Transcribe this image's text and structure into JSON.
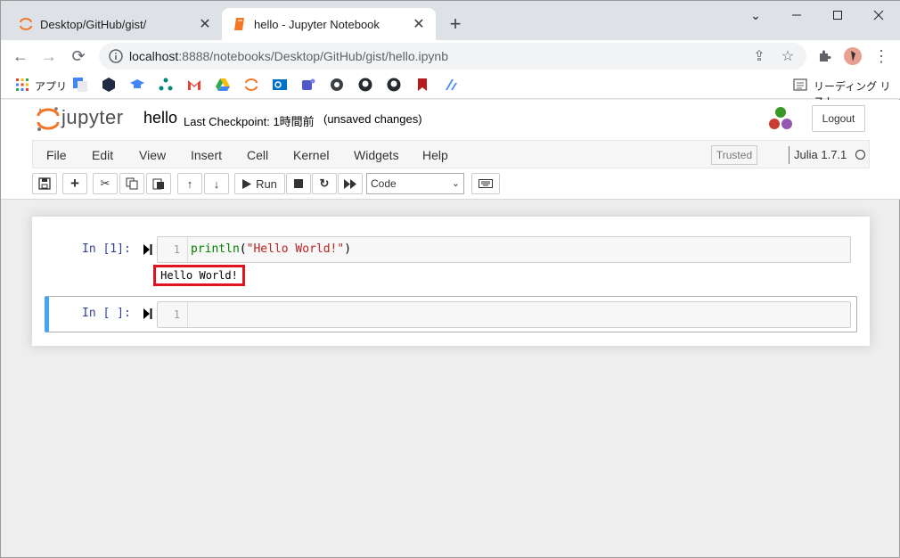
{
  "browser": {
    "tabs": [
      {
        "title": "Desktop/GitHub/gist/",
        "active": false
      },
      {
        "title": "hello - Jupyter Notebook",
        "active": true
      }
    ],
    "url_host": "localhost",
    "url_path": ":8888/notebooks/Desktop/GitHub/gist/hello.ipynb",
    "bookmarks_apps_label": "アプリ",
    "reading_list_label": "リーディング リスト"
  },
  "jupyter": {
    "logo_text": "jupyter",
    "notebook_name": "hello",
    "checkpoint": "Last Checkpoint: 1時間前",
    "unsaved": "(unsaved changes)",
    "logout_label": "Logout",
    "menu": [
      "File",
      "Edit",
      "View",
      "Insert",
      "Cell",
      "Kernel",
      "Widgets",
      "Help"
    ],
    "trusted_label": "Trusted",
    "kernel_name": "Julia 1.7.1",
    "run_label": "Run",
    "cell_type": "Code"
  },
  "cells": [
    {
      "prompt": "In [1]:",
      "line_number": "1",
      "code_func": "println",
      "code_open": "(",
      "code_string": "\"Hello World!\"",
      "code_close": ")",
      "output": "Hello World!"
    },
    {
      "prompt": "In [ ]:",
      "line_number": "1"
    }
  ],
  "colors": {
    "jupyter_orange": "#f37626",
    "prompt_blue": "#303f9f",
    "selected_cell_bar": "#42a5f5",
    "highlight_red": "#e0141e"
  }
}
